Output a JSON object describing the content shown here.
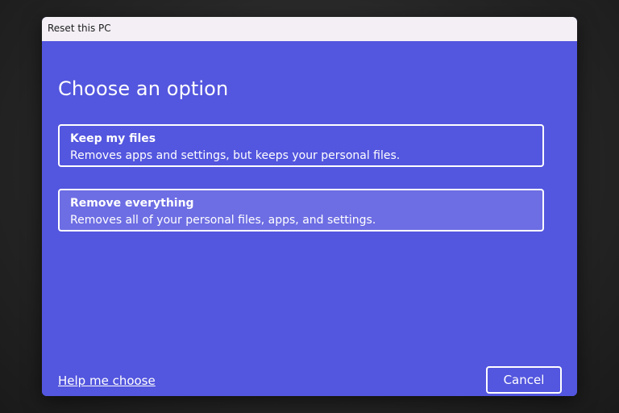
{
  "window": {
    "title": "Reset this PC"
  },
  "page": {
    "heading": "Choose an option"
  },
  "options": [
    {
      "title": "Keep my files",
      "description": "Removes apps and settings, but keeps your personal files."
    },
    {
      "title": "Remove everything",
      "description": "Removes all of your personal files, apps, and settings."
    }
  ],
  "footer": {
    "help_link": "Help me choose",
    "cancel_label": "Cancel"
  },
  "colors": {
    "dialog_background": "#5356de",
    "hovered_option": "#6d6de4",
    "title_bar": "#f3eff5",
    "text": "#ffffff"
  }
}
